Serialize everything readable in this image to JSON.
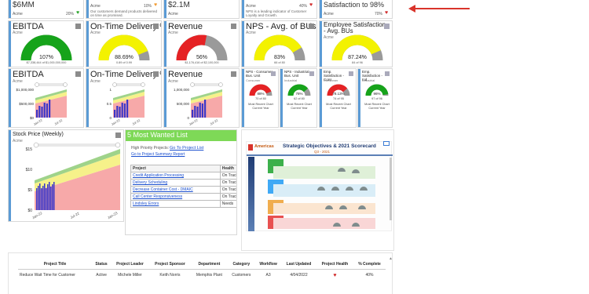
{
  "top_row": [
    {
      "value": "$6MM",
      "company": "Acme",
      "pct": "20%",
      "status": "up-green"
    },
    {
      "value": "",
      "company": "Acme",
      "pct": "10%",
      "status": "heart-orange",
      "desc": "Our customers demand products delivered on time as promised."
    },
    {
      "value": "$2.1M",
      "company": "Acme",
      "pct": "",
      "status": ""
    },
    {
      "value": "",
      "company": "Acme",
      "pct": "40%",
      "status": "heart-red",
      "desc": "NPS is a leading indicator of Customer Loyalty and Growth."
    },
    {
      "value": "Satisfaction to 98%",
      "company": "Acme",
      "pct": "70%",
      "status": "heart-red"
    }
  ],
  "gauges": [
    {
      "title": "EBITDA",
      "company": "Acme",
      "value_label": "107%",
      "detail": "$7,338,444 of $1,000,000,000",
      "fill": 1.0,
      "color": "#16a31a"
    },
    {
      "title": "On-Time Delivery %",
      "company": "Acme",
      "value_label": "88.69%",
      "detail": "0.89 of 0.99",
      "fill": 0.88,
      "color": "#f3f200"
    },
    {
      "title": "Revenue",
      "company": "Acme",
      "value_label": "56%",
      "detail": "$1,176,416 of $2,100,000",
      "fill": 0.56,
      "color": "#e52224"
    },
    {
      "title": "NPS - Avg. of BUs",
      "company": "Acme",
      "value_label": "83%",
      "detail": "66 of 80",
      "fill": 0.83,
      "color": "#f3f200"
    },
    {
      "title": "Employee Satisfaction - Avg. BUs",
      "company": "Acme",
      "value_label": "87.24%",
      "detail": "84 of 96",
      "fill": 0.87,
      "color": "#f3f200"
    }
  ],
  "trend_charts": [
    {
      "title": "EBITDA",
      "company": "Acme",
      "y_ticks": [
        "$1,000,000",
        "$500,000",
        "$0"
      ],
      "x_ticks": [
        "Jan-22",
        "Jul-22"
      ]
    },
    {
      "title": "On-Time Delivery %",
      "company": "Acme",
      "y_ticks": [
        "1",
        "0.5",
        "0"
      ],
      "x_ticks": [
        "Jan-22",
        "Jul-22"
      ]
    },
    {
      "title": "Revenue",
      "company": "Acme",
      "y_ticks": [
        "1,000,000",
        "500,000",
        "0"
      ],
      "x_ticks": [
        "Jan-22",
        "Jul-22"
      ]
    }
  ],
  "small_gauges": [
    {
      "title": "NPS - Consumer Bus. Unit",
      "company": "Consumer",
      "value_label": "88%",
      "detail": "70 of 80",
      "fill": 0.88,
      "color": "#e52224",
      "caption1": "Most Recent Chart",
      "caption2": "Current Year"
    },
    {
      "title": "NPS - Industrial Bus. Unit",
      "company": "Industrial",
      "value_label": "78%",
      "detail": "62 of 80",
      "fill": 0.78,
      "color": "#16a31a",
      "caption1": "Most Recent Chart",
      "caption2": "Current Year"
    },
    {
      "title": "Emp. Satisfaction - Cons",
      "company": "Consumer",
      "value_label": "78.13%",
      "detail": "74 of 95",
      "fill": 0.78,
      "color": "#e52224",
      "caption1": "Most Recent Chart",
      "caption2": "Current Year"
    },
    {
      "title": "Emp. Satisfaction - Ind.",
      "company": "Industrial",
      "value_label": "96%",
      "detail": "97 of 96",
      "fill": 0.96,
      "color": "#16a31a",
      "caption1": "Most Recent Chart",
      "caption2": "Current Year"
    }
  ],
  "stock": {
    "title": "Stock Price (Weekly)",
    "company": "Acme",
    "y_ticks": [
      "$15",
      "$10",
      "$5",
      "$0"
    ],
    "x_ticks": [
      "Jan-22",
      "Jul-22",
      "Jan-23"
    ]
  },
  "wanted": {
    "title": "5 Most Wanted List",
    "hp_label": "High Priority Projects:",
    "hp_link": "Go To Project List",
    "summary_link": "Go to Project Summary Report",
    "col_project": "Project",
    "col_health": "Health",
    "rows": [
      {
        "name": "Credit Application Processing",
        "health": "On Track"
      },
      {
        "name": "Delivery Scheduling",
        "health": "On Track"
      },
      {
        "name": "Decrease Container Cost - DMAIC",
        "health": "On Track"
      },
      {
        "name": "Call Center Responsiveness",
        "health": "On Track"
      },
      {
        "name": "Lindsley Errors",
        "health": "Needs"
      }
    ]
  },
  "scorecard": {
    "brand": "Americas",
    "title": "Strategic Objectives & 2021 Scorecard",
    "subtitle": "Q3 - 2021"
  },
  "project_table": {
    "headers": [
      "Project Title",
      "Status",
      "Project Leader",
      "Project Sponsor",
      "Department",
      "Category",
      "Workflow",
      "Last Updated",
      "Project Health",
      "% Complete"
    ],
    "rows": [
      [
        "Reduce Wait Time for Customer",
        "Active",
        "Michele Miller",
        "Keith Norris",
        "Memphis Plant",
        "Customers",
        "A3",
        "4/04/2022",
        "heart",
        "40%"
      ]
    ]
  },
  "colors": {
    "accent": "#5b9bd5",
    "arrow": "#d9342b",
    "green_band": "#9fd38a",
    "yellow_band": "#f6f18a",
    "red_band": "#f7a9a9",
    "bar": "#3b37c9",
    "wanted_header": "#7ed957"
  }
}
